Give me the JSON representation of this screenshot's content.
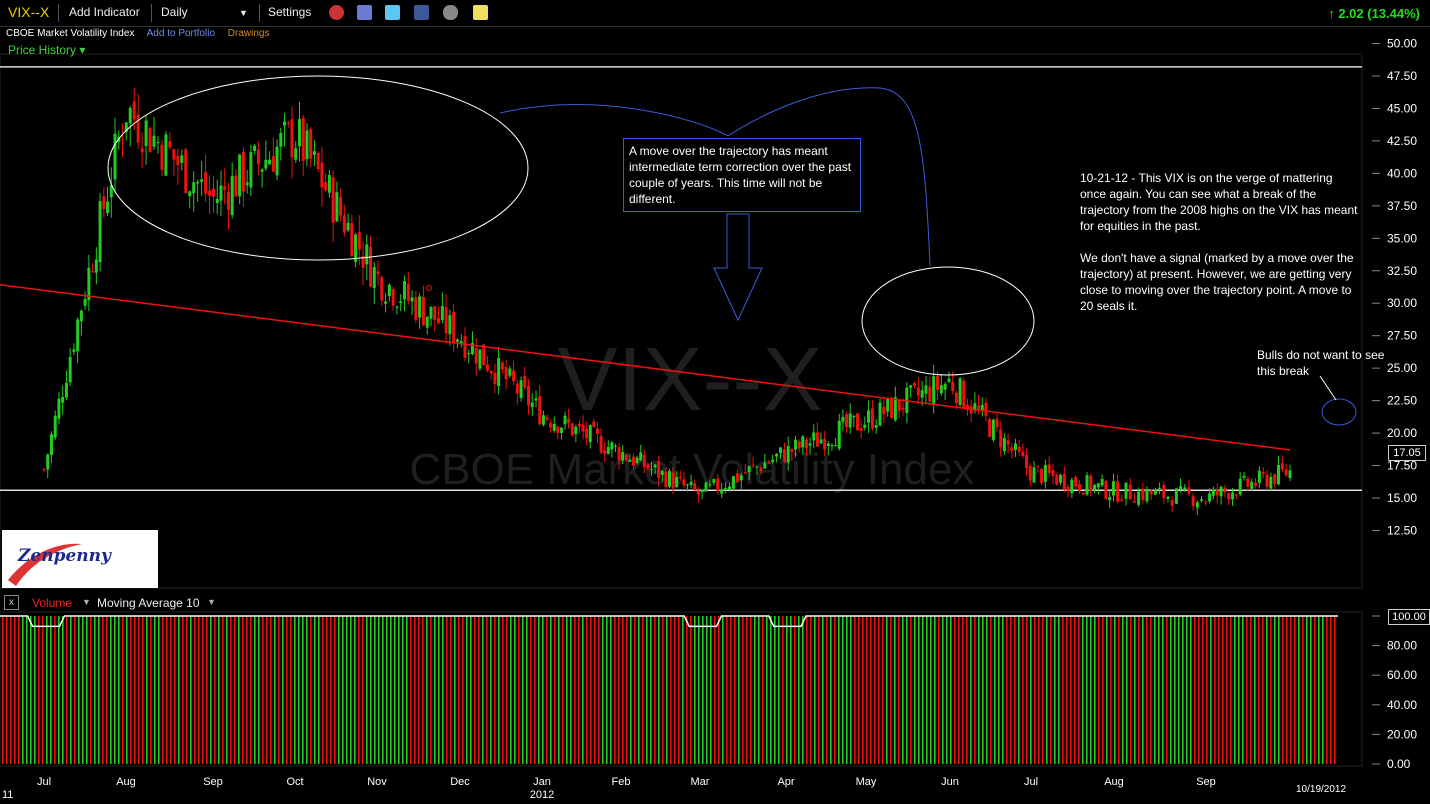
{
  "toolbar": {
    "symbol": "VIX--X",
    "add_indicator": "Add Indicator",
    "period": "Daily",
    "period_arrow": "▼",
    "settings": "Settings",
    "change": "↑ 2.02 (13.44%)"
  },
  "subheader": {
    "name": "CBOE Market Volatility Index",
    "add_to_portfolio": "Add to Portfolio",
    "drawings": "Drawings"
  },
  "price_history_label": "Price History ▾",
  "watermark": {
    "symbol": "VIX--X",
    "name": "CBOE Market Volatility Index"
  },
  "annotations": {
    "box1": "A move over the trajectory has meant intermediate term correction over the past couple of years. This time will not be different.",
    "note1_p1": "10-21-12 - This VIX is on the verge of mattering once again. You can see what a break of the trajectory from the 2008 highs on the VIX has meant for equities in the past.",
    "note1_p2": "We don't have a signal (marked by a move over the trajectory) at present. However, we are getting very close to moving over the trajectory point. A move to 20 seals it.",
    "note2": "Bulls do not want to see this break"
  },
  "logo": "Zenpenny",
  "volume_header": {
    "close": "x",
    "volume": "Volume",
    "ma": "Moving Average 10"
  },
  "last_price": "17.05",
  "volume_last": "100.00",
  "date_stamp": "10/19/2012",
  "year_label": "2012",
  "left_edge_label": "11",
  "colors": {
    "up": "#22cc22",
    "down": "#ee1111",
    "trendline": "#ee1111",
    "ellipse": "#ffffff",
    "arrow": "#3a5bd8"
  },
  "chart_data": [
    {
      "type": "candlestick",
      "title": "VIX--X",
      "subtitle": "CBOE Market Volatility Index",
      "x_ticks": [
        "Jul",
        "Aug",
        "Sep",
        "Oct",
        "Nov",
        "Dec",
        "Jan",
        "Feb",
        "Mar",
        "Apr",
        "May",
        "Jun",
        "Jul",
        "Aug",
        "Sep"
      ],
      "y_ticks": [
        "12.50",
        "15.00",
        "17.50",
        "20.00",
        "22.50",
        "25.00",
        "27.50",
        "30.00",
        "32.50",
        "35.00",
        "37.50",
        "40.00",
        "42.50",
        "45.00",
        "47.50",
        "50.00"
      ],
      "ylim": [
        11.5,
        51.5
      ],
      "horizontal_lines": [
        48.2,
        15.6
      ],
      "trendline": {
        "from": {
          "date": "Jun 2011",
          "value": 31.8
        },
        "to": {
          "date": "Oct 2012",
          "value": 18.7
        }
      },
      "series": [
        {
          "date": "Jul 2011",
          "value": 17.2
        },
        {
          "date": "Aug 2011",
          "value": 45.0
        },
        {
          "date": "Sep 2011",
          "value": 38.0
        },
        {
          "date": "Oct 2011",
          "value": 43.0
        },
        {
          "date": "Nov 2011",
          "value": 32.0
        },
        {
          "date": "Dec 2011",
          "value": 27.5
        },
        {
          "date": "Jan 2012",
          "value": 21.5
        },
        {
          "date": "Feb 2012",
          "value": 18.5
        },
        {
          "date": "Mar 2012",
          "value": 15.2
        },
        {
          "date": "Apr 2012",
          "value": 18.5
        },
        {
          "date": "May 2012",
          "value": 21.0
        },
        {
          "date": "Jun 2012",
          "value": 24.0
        },
        {
          "date": "Jul 2012",
          "value": 17.0
        },
        {
          "date": "Aug 2012",
          "value": 15.5
        },
        {
          "date": "Sep 2012",
          "value": 15.0
        },
        {
          "date": "Oct 2012",
          "value": 17.05
        }
      ]
    },
    {
      "type": "bar",
      "title": "Volume",
      "ma_label": "Moving Average 10",
      "y_ticks": [
        "0.00",
        "20.00",
        "40.00",
        "60.00",
        "80.00",
        "100.00"
      ],
      "ylim": [
        0,
        100
      ],
      "ma_value": 100,
      "ma_dips": [
        {
          "from": "Jul 2011",
          "to": "Jul 2011",
          "value": 93
        },
        {
          "from": "Mar 2012",
          "to": "Mar 2012",
          "value": 93
        },
        {
          "from": "Apr 2012",
          "to": "Apr 2012",
          "value": 93
        }
      ]
    }
  ]
}
